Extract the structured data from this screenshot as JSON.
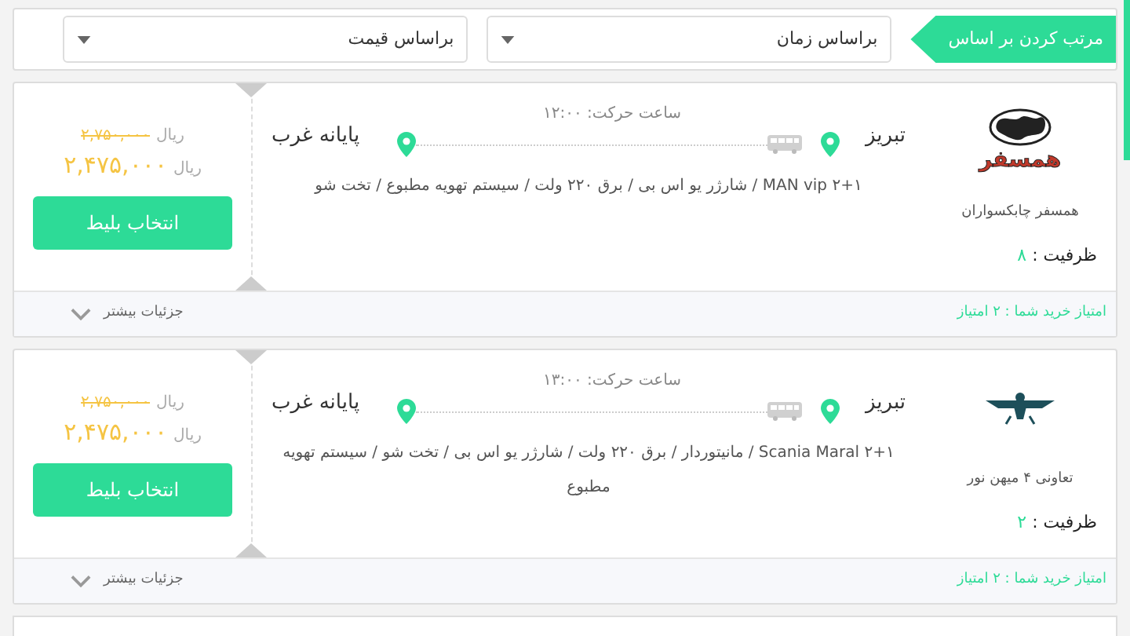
{
  "sort_bar": {
    "label": "مرتب کردن بر اساس",
    "dropdowns": [
      {
        "value": "براساس زمان"
      },
      {
        "value": "براساس قیمت"
      }
    ]
  },
  "trips": [
    {
      "logo": {
        "kind": "globe",
        "text": "همسفر"
      },
      "company": "همسفر چابکسواران",
      "capacity_label": "ظرفیت :",
      "capacity": "۸",
      "departure": "ساعت حرکت: ۱۲:۰۰",
      "origin": "تبریز",
      "destination": "پایانه غرب",
      "features": "MAN vip ۲+۱ / شارژر یو اس بی / برق ۲۲۰ ولت / سیستم تهویه مطبوع / تخت شو",
      "old_price": "۲,۷۵۰,۰۰۰",
      "old_currency": "ریال",
      "price": "۲,۴۷۵,۰۰۰",
      "currency": "ریال",
      "button": "انتخاب بلیط",
      "score": "امتیاز خرید شما : ۲ امتیاز",
      "details": "جزئیات بیشتر"
    },
    {
      "logo": {
        "kind": "wings"
      },
      "company": "تعاونی ۴ میهن نور",
      "capacity_label": "ظرفیت :",
      "capacity": "۲",
      "departure": "ساعت حرکت: ۱۳:۰۰",
      "origin": "تبریز",
      "destination": "پایانه غرب",
      "features": "Scania Maral ۲+۱ / مانیتوردار / برق ۲۲۰ ولت / شارژر یو اس بی / تخت شو / سیستم تهویه مطبوع",
      "old_price": "۲,۷۵۰,۰۰۰",
      "old_currency": "ریال",
      "price": "۲,۴۷۵,۰۰۰",
      "currency": "ریال",
      "button": "انتخاب بلیط",
      "score": "امتیاز خرید شما : ۲ امتیاز",
      "details": "جزئیات بیشتر"
    }
  ]
}
